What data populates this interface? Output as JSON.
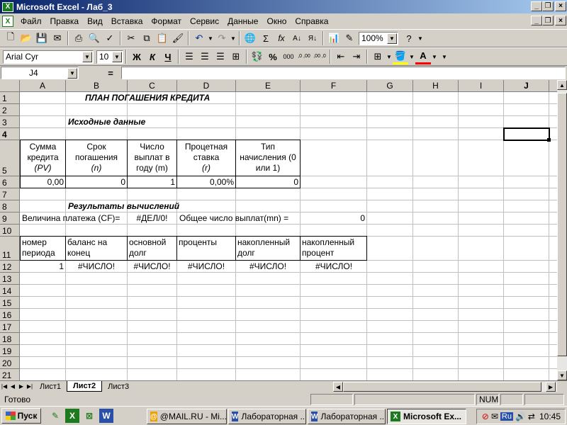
{
  "window": {
    "title": "Microsoft Excel - Лаб_3"
  },
  "menu": [
    "Файл",
    "Правка",
    "Вид",
    "Вставка",
    "Формат",
    "Сервис",
    "Данные",
    "Окно",
    "Справка"
  ],
  "toolbar": {
    "zoom": "100%",
    "font_name": "Arial Cyr",
    "font_size": "10",
    "bold": "Ж",
    "italic": "К",
    "underline": "Ч",
    "sigma": "Σ",
    "fx": "fx",
    "percent": "%",
    "thousands": "000",
    "inc_decimal": ",0 ,00",
    "dec_decimal": ",00 ,0"
  },
  "formula_bar": {
    "name_box": "J4",
    "equals": "=",
    "value": ""
  },
  "columns": [
    "A",
    "B",
    "C",
    "D",
    "E",
    "F",
    "G",
    "H",
    "I",
    "J"
  ],
  "rows": [
    "1",
    "2",
    "3",
    "4",
    "5",
    "6",
    "7",
    "8",
    "9",
    "10",
    "11",
    "12",
    "13",
    "14",
    "15",
    "16",
    "17",
    "18",
    "19",
    "20",
    "21"
  ],
  "sheet": {
    "title": "ПЛАН ПОГАШЕНИЯ КРЕДИТА",
    "input_heading": "Исходные данные",
    "input_headers": {
      "a": [
        "Сумма",
        "кредита",
        "(PV)"
      ],
      "b": [
        "Срок",
        "погашения",
        "(n)"
      ],
      "c": [
        "Число",
        "выплат в",
        "году (m)"
      ],
      "d": [
        "Процетная",
        "ставка",
        "(r)"
      ],
      "e": [
        "Тип",
        "начисления (0",
        "или 1)"
      ]
    },
    "input_values": {
      "a": "0,00",
      "b": "0",
      "c": "1",
      "d": "0,00%",
      "e": "0"
    },
    "results_heading": "Результаты вычислений",
    "payment_label": "Величина платежа (CF)=",
    "payment_value": "#ДЕЛ/0!",
    "total_payments_label": "Общее число выплат(mn) =",
    "total_payments_value": "0",
    "table_headers": {
      "a": [
        "номер",
        "периода"
      ],
      "b": [
        "баланс на",
        "конец"
      ],
      "c": [
        "основной",
        "долг"
      ],
      "d": [
        "проценты",
        ""
      ],
      "e": [
        "накопленный",
        "долг"
      ],
      "f": [
        "накопленный",
        "процент"
      ]
    },
    "row12": {
      "a": "1",
      "b": "#ЧИСЛО!",
      "c": "#ЧИСЛО!",
      "d": "#ЧИСЛО!",
      "e": "#ЧИСЛО!",
      "f": "#ЧИСЛО!"
    }
  },
  "sheet_tabs": [
    "Лист1",
    "Лист2",
    "Лист3"
  ],
  "active_tab": "Лист2",
  "status": {
    "ready": "Готово",
    "num": "NUM"
  },
  "taskbar": {
    "start": "Пуск",
    "tasks": [
      "@MAIL.RU - Mi...",
      "Лабораторная ...",
      "Лабораторная ...",
      "Microsoft Ex..."
    ],
    "lang": "Ru",
    "clock": "10:45"
  },
  "colors": {
    "title_start": "#0a246a",
    "title_end": "#a6caf0",
    "excel_green": "#1e7a1e"
  }
}
